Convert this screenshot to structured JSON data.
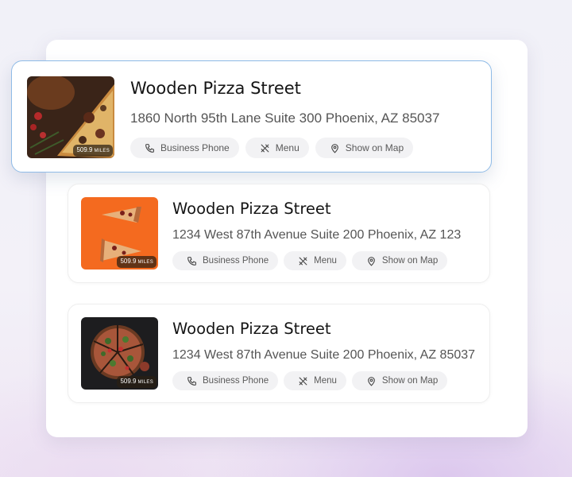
{
  "listings": [
    {
      "title": "Wooden Pizza Street",
      "address": "1860 North 95th Lane Suite 300 Phoenix, AZ 85037",
      "distance": "509.9",
      "distance_unit": "MILES",
      "actions": {
        "phone": "Business Phone",
        "menu": "Menu",
        "map": "Show on Map"
      }
    },
    {
      "title": "Wooden Pizza Street",
      "address": "1234 West 87th Avenue Suite 200 Phoenix, AZ 123",
      "distance": "509.9",
      "distance_unit": "MILES",
      "actions": {
        "phone": "Business Phone",
        "menu": "Menu",
        "map": "Show on Map"
      }
    },
    {
      "title": "Wooden Pizza Street",
      "address": "1234 West 87th Avenue Suite 200 Phoenix, AZ 85037",
      "distance": "509.9",
      "distance_unit": "MILES",
      "actions": {
        "phone": "Business Phone",
        "menu": "Menu",
        "map": "Show on Map"
      }
    }
  ],
  "icons": {
    "phone": "phone-icon",
    "menu": "fork-knife-icon",
    "map": "map-pin-icon"
  },
  "colors": {
    "selected_border": "#8fbbe7",
    "chip_bg": "#f2f2f4",
    "thumb2_bg": "#f46a1f"
  }
}
